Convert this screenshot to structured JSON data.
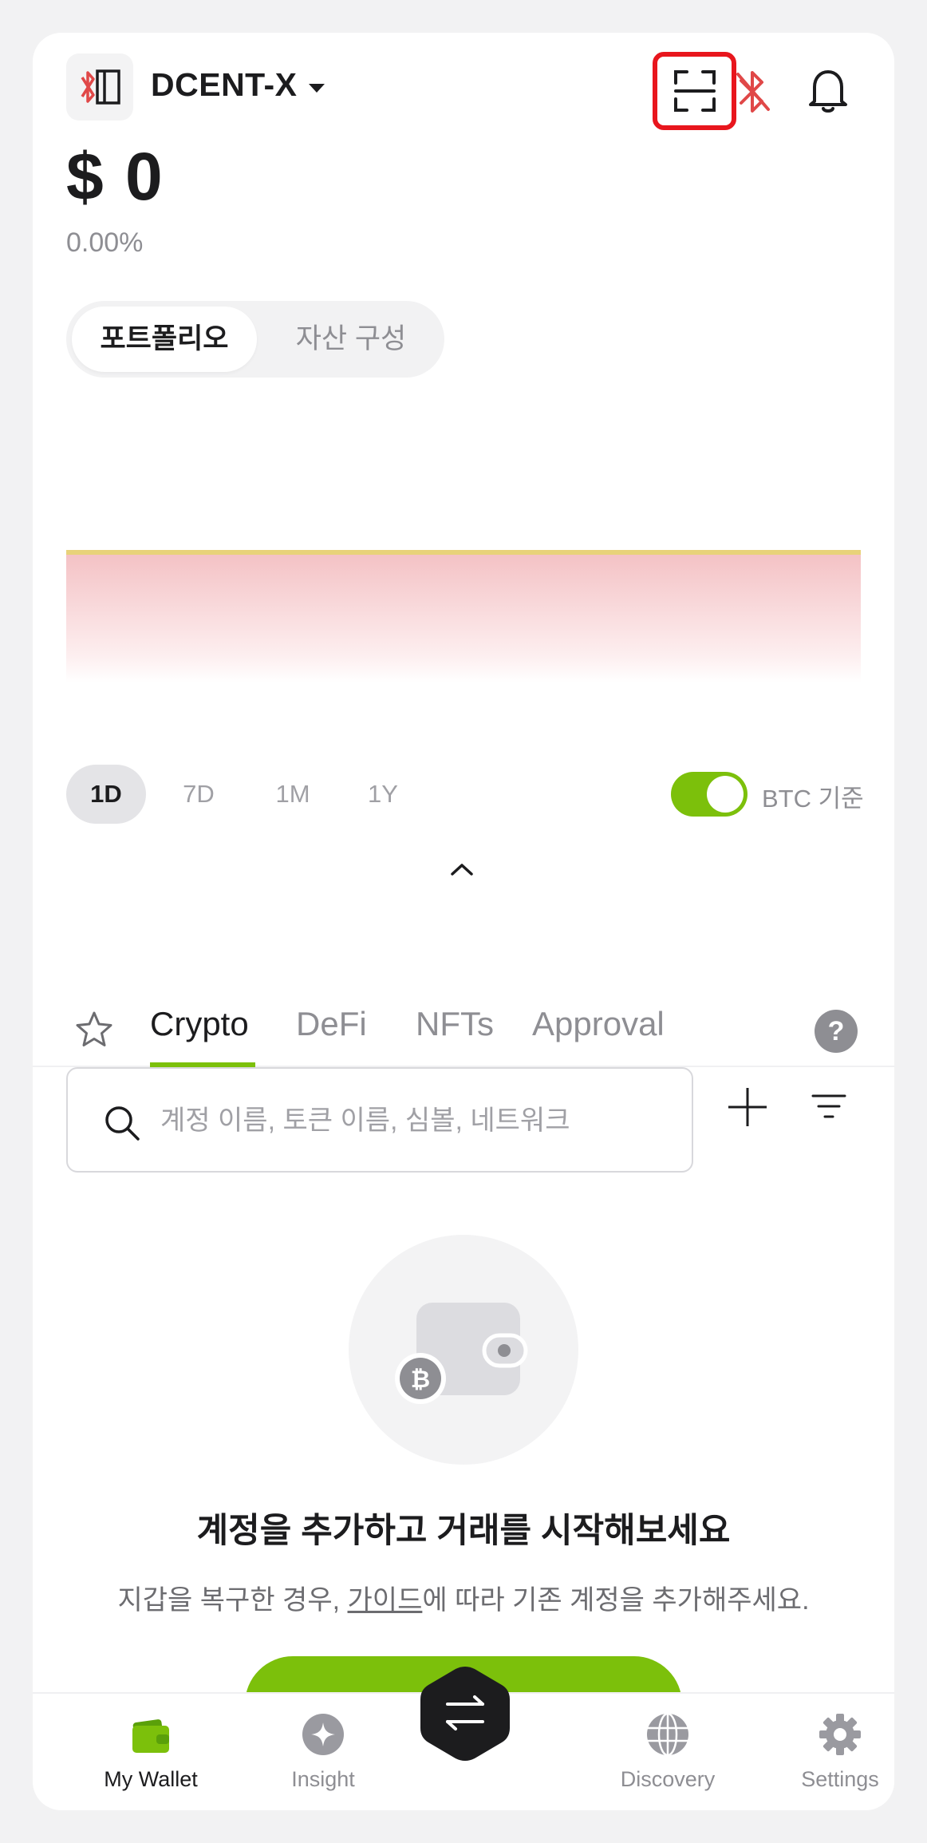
{
  "header": {
    "device_name": "DCENT-X"
  },
  "balance": {
    "amount": "$ 0",
    "change": "0.00%"
  },
  "segment": {
    "options": [
      "포트폴리오",
      "자산 구성"
    ],
    "selected": "포트폴리오"
  },
  "periods": {
    "options": [
      "1D",
      "7D",
      "1M",
      "1Y"
    ],
    "selected": "1D"
  },
  "btc_toggle": {
    "label": "BTC 기준",
    "on": true
  },
  "asset_tabs": {
    "items": [
      "Crypto",
      "DeFi",
      "NFTs",
      "Approval"
    ],
    "selected": "Crypto"
  },
  "search": {
    "placeholder": "계정 이름, 토큰 이름, 심볼, 네트워크",
    "value": ""
  },
  "empty_state": {
    "title": "계정을 추가하고 거래를 시작해보세요",
    "desc_before": "지갑을 복구한 경우, ",
    "desc_link": "가이드",
    "desc_after": "에 따라 기존 계정을 추가해주세요."
  },
  "bottom_nav": {
    "items": [
      {
        "label": "My Wallet",
        "icon": "wallet-icon"
      },
      {
        "label": "Insight",
        "icon": "sparkle-icon"
      },
      {
        "label": "Discovery",
        "icon": "globe-icon"
      },
      {
        "label": "Settings",
        "icon": "gear-icon"
      }
    ],
    "selected": "My Wallet"
  },
  "colors": {
    "accent": "#7cc00b",
    "highlight": "#e8161d",
    "bluetooth": "#e04848"
  },
  "help_glyph": "?"
}
